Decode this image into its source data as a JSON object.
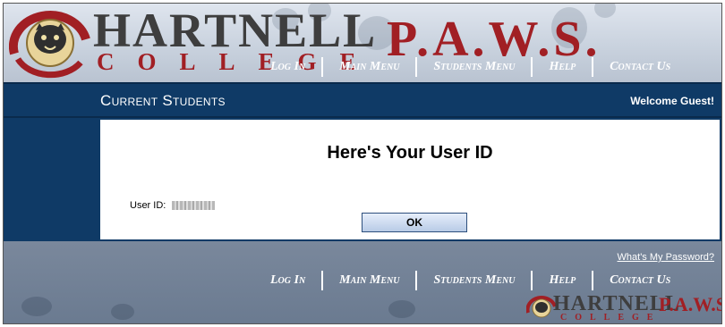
{
  "branding": {
    "name": "HARTNELL",
    "college": "COLLEGE",
    "product": "P.A.W.S."
  },
  "nav": {
    "items": [
      "Log In",
      "Main Menu",
      "Students Menu",
      "Help",
      "Contact Us"
    ]
  },
  "section": {
    "title": "Current Students",
    "welcome": "Welcome Guest!"
  },
  "main": {
    "heading": "Here's Your User ID",
    "user_id_label": "User ID:",
    "user_id_value": "",
    "ok_label": "OK"
  },
  "footer": {
    "password_link": "What's My Password?"
  },
  "colors": {
    "brand_red": "#a11f24",
    "navy": "#0f3a66",
    "header_grey": "#c9d2de"
  }
}
